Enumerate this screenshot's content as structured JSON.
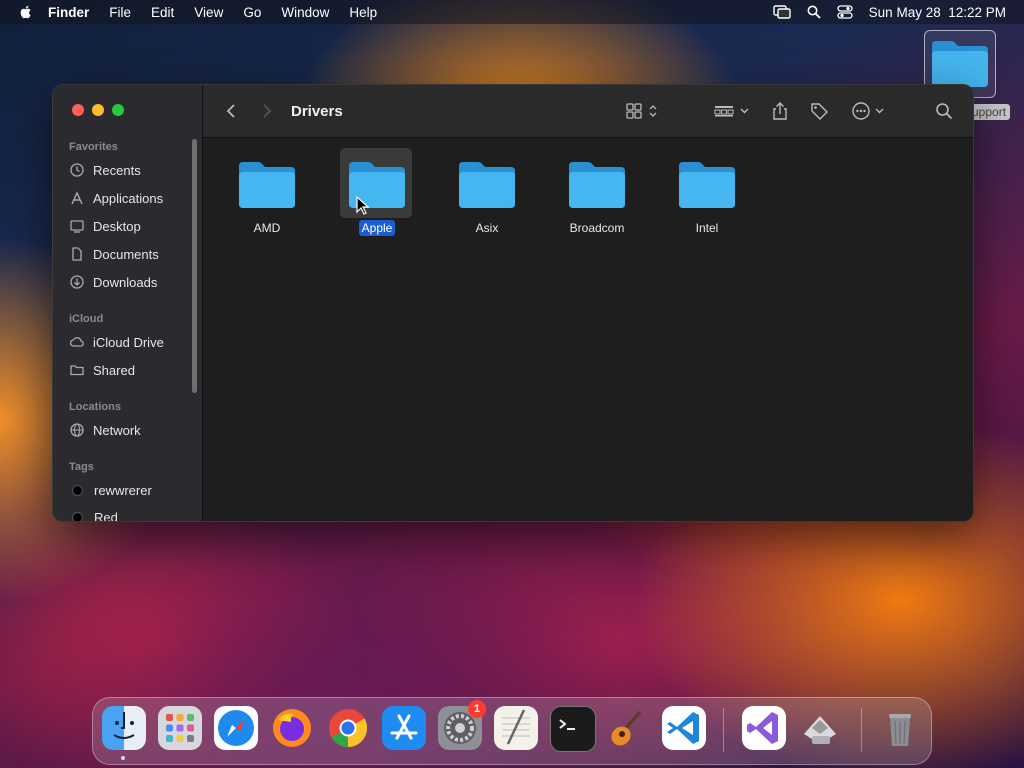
{
  "menubar": {
    "app_name": "Finder",
    "items": [
      "File",
      "Edit",
      "View",
      "Go",
      "Window",
      "Help"
    ],
    "datetime": "Sun May 28  12:22 PM"
  },
  "desktop": {
    "folder_label": "upport"
  },
  "window": {
    "title": "Drivers",
    "sidebar": {
      "favorites_header": "Favorites",
      "favorites": [
        {
          "label": "Recents",
          "icon": "clock-icon"
        },
        {
          "label": "Applications",
          "icon": "applications-icon"
        },
        {
          "label": "Desktop",
          "icon": "desktop-icon"
        },
        {
          "label": "Documents",
          "icon": "document-icon"
        },
        {
          "label": "Downloads",
          "icon": "download-icon"
        }
      ],
      "icloud_header": "iCloud",
      "icloud": [
        {
          "label": "iCloud Drive",
          "icon": "cloud-icon"
        },
        {
          "label": "Shared",
          "icon": "shared-folder-icon"
        }
      ],
      "locations_header": "Locations",
      "locations": [
        {
          "label": "Network",
          "icon": "globe-icon"
        }
      ],
      "tags_header": "Tags",
      "tags": [
        {
          "label": "rewwrerer",
          "color": "#000000"
        },
        {
          "label": "Red",
          "color": "#000000"
        }
      ]
    },
    "files": [
      {
        "name": "AMD",
        "selected": false
      },
      {
        "name": "Apple",
        "selected": true
      },
      {
        "name": "Asix",
        "selected": false
      },
      {
        "name": "Broadcom",
        "selected": false
      },
      {
        "name": "Intel",
        "selected": false
      }
    ]
  },
  "dock": {
    "apps": [
      "Finder",
      "Launchpad",
      "Safari",
      "Firefox",
      "Chrome",
      "App Store",
      "System Settings",
      "TextEdit",
      "Terminal",
      "GarageBand",
      "Visual Studio Code",
      "Visual Studio",
      "Boot Camp Assistant",
      "Trash"
    ],
    "settings_badge": "1"
  },
  "colors": {
    "accent": "#1a5fd1",
    "folder": "#3fb4ee",
    "close": "#ff5f57",
    "minimize": "#febc2e",
    "zoom": "#28c840"
  }
}
